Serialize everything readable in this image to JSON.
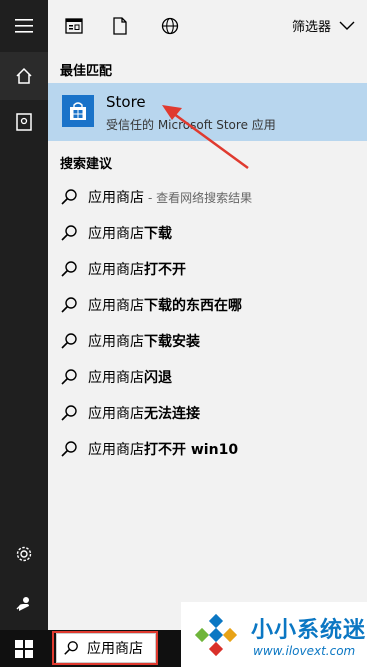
{
  "rail": {
    "icons": [
      "hamburger-icon",
      "home-icon",
      "notebook-icon",
      "settings-icon",
      "feedback-icon"
    ]
  },
  "toolbar": {
    "icons": [
      "apps-icon",
      "document-icon",
      "web-icon"
    ],
    "filter_label": "筛选器"
  },
  "best_match": {
    "heading": "最佳匹配",
    "app_name": "Store",
    "app_subtitle": "受信任的 Microsoft Store 应用"
  },
  "suggestions": {
    "heading": "搜索建议",
    "items": [
      {
        "base": "应用商店",
        "bold": "",
        "note": "- 查看网络搜索结果"
      },
      {
        "base": "应用商店",
        "bold": "下载",
        "note": ""
      },
      {
        "base": "应用商店",
        "bold": "打不开",
        "note": ""
      },
      {
        "base": "应用商店",
        "bold": "下载的东西在哪",
        "note": ""
      },
      {
        "base": "应用商店",
        "bold": "下载安装",
        "note": ""
      },
      {
        "base": "应用商店",
        "bold": "闪退",
        "note": ""
      },
      {
        "base": "应用商店",
        "bold": "无法连接",
        "note": ""
      },
      {
        "base": "应用商店",
        "bold": "打不开 win10",
        "note": ""
      }
    ]
  },
  "taskbar": {
    "search_value": "应用商店"
  },
  "watermark": {
    "title": "小小系统迷",
    "url": "www.ilovext.com"
  },
  "colors": {
    "rail": "#1f1f1f",
    "highlight": "#b8d6ee",
    "store_blue": "#1a73c9",
    "annotation_red": "#e03a2f"
  }
}
